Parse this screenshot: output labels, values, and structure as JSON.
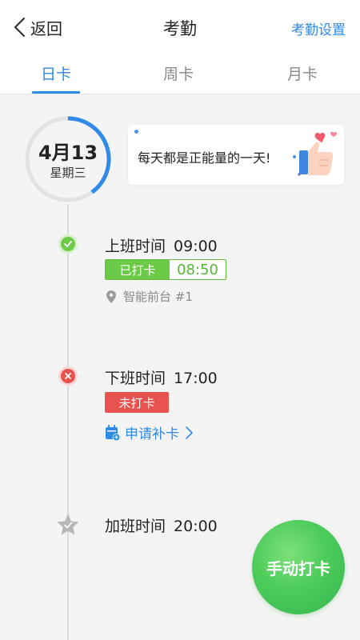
{
  "header": {
    "back_label": "返回",
    "title": "考勤",
    "settings_label": "考勤设置"
  },
  "tabs": [
    {
      "label": "日卡",
      "active": true
    },
    {
      "label": "周卡",
      "active": false
    },
    {
      "label": "月卡",
      "active": false
    }
  ],
  "date": {
    "day": "4月13",
    "weekday": "星期三",
    "day_progress_fraction": 0.4
  },
  "motto": {
    "text": "每天都是正能量的一天!",
    "icon": "thumbs-up-icon"
  },
  "timeline": {
    "checkin": {
      "label": "上班时间",
      "time": "09:00",
      "status_label": "已打卡",
      "punch_time": "08:50",
      "location": "智能前台 #1",
      "status": "done",
      "icon": "check-icon"
    },
    "checkout": {
      "label": "下班时间",
      "time": "17:00",
      "status_label": "未打卡",
      "apply_label": "申请补卡",
      "status": "missed",
      "icon": "close-icon"
    },
    "overtime": {
      "label": "加班时间",
      "time": "20:00",
      "icon": "star-icon"
    }
  },
  "punch_button": {
    "label": "手动打卡"
  },
  "colors": {
    "accent": "#2f8ae8",
    "success": "#6ccb46",
    "danger": "#e8534f",
    "punch_green": "#4ccc5a"
  }
}
